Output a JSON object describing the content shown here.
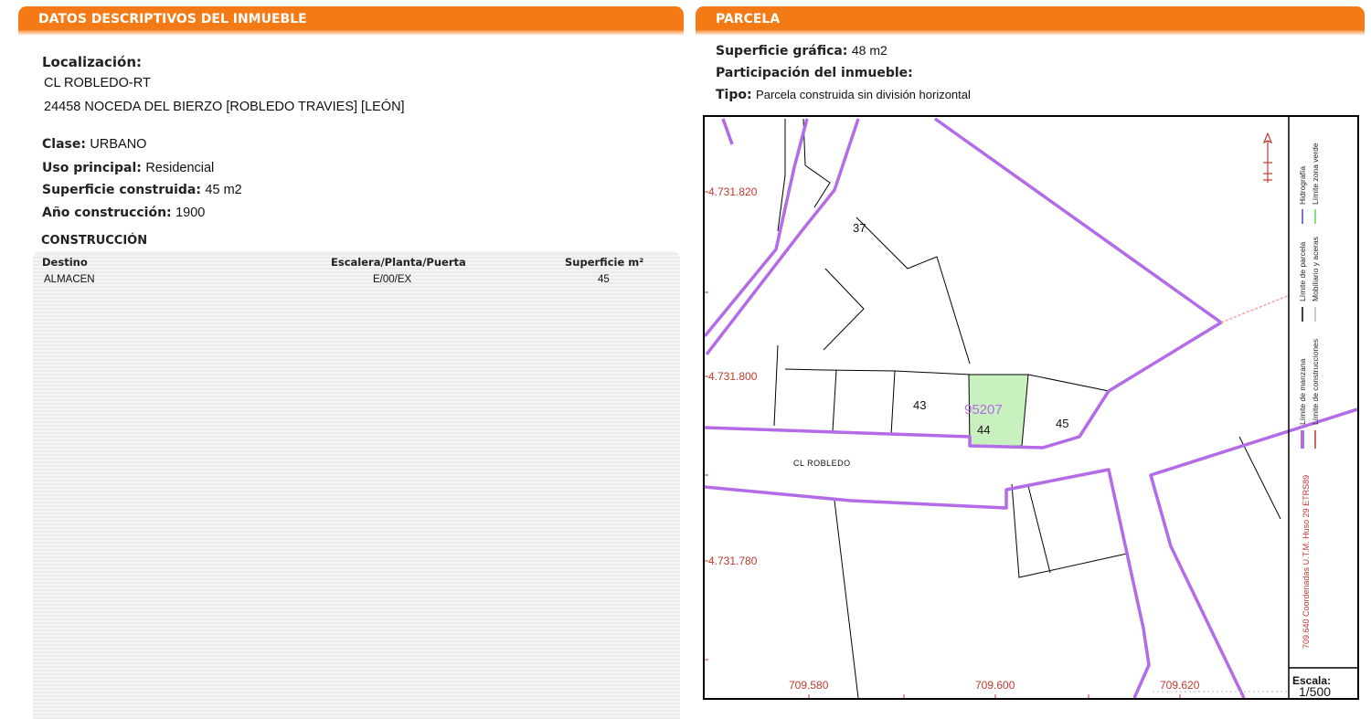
{
  "left": {
    "header": "DATOS DESCRIPTIVOS DEL INMUEBLE",
    "localizacion": {
      "label": "Localización:",
      "line1": "CL ROBLEDO-RT",
      "line2": "24458 NOCEDA DEL BIERZO [ROBLEDO TRAVIES] [LEÓN]"
    },
    "clase": {
      "label": "Clase:",
      "value": "URBANO"
    },
    "uso": {
      "label": "Uso principal:",
      "value": "Residencial"
    },
    "superficie": {
      "label": "Superficie construida:",
      "value": "45 m2"
    },
    "anio": {
      "label": "Año construcción:",
      "value": "1900"
    },
    "construccion": {
      "title": "CONSTRUCCIÓN",
      "headers": {
        "destino": "Destino",
        "escalera": "Escalera/Planta/Puerta",
        "superficie": "Superficie m²"
      },
      "rows": [
        {
          "destino": "ALMACEN",
          "escalera": "E/00/EX",
          "superficie": "45"
        }
      ]
    }
  },
  "right": {
    "header": "PARCELA",
    "superficie_grafica": {
      "label": "Superficie gráfica:",
      "value": "48 m2"
    },
    "participacion": {
      "label": "Participación del inmueble:",
      "value": ""
    },
    "tipo": {
      "label": "Tipo:",
      "value": "Parcela construida sin división horizontal"
    }
  },
  "map": {
    "y_coords": [
      "4.731.820",
      "4.731.800",
      "4.731.780"
    ],
    "x_coords": [
      "709.580",
      "709.600",
      "709.620"
    ],
    "street": "CL ROBLEDO",
    "parcel_ref": "95207",
    "numbers": {
      "n37": "37",
      "n43": "43",
      "n44": "44",
      "n45": "45"
    },
    "coord_system": "709.640 Coordenadas U.T.M. Huso 29 ETRS89",
    "legend": {
      "manzana": "Límite de manzana",
      "construcciones": "Límite de construcciones",
      "parcela": "Límite de parcela",
      "mobiliario": "Mobiliario y aceras",
      "hidrografia": "Hidrografía",
      "zona_verde": "Límite zona verde"
    },
    "escala": {
      "label": "Escala:",
      "value": "1/500"
    },
    "colors": {
      "manzana": "#b36be8",
      "selected_fill": "#c9f0bf",
      "coords": "#c0392b",
      "header": "#f47a15"
    }
  }
}
